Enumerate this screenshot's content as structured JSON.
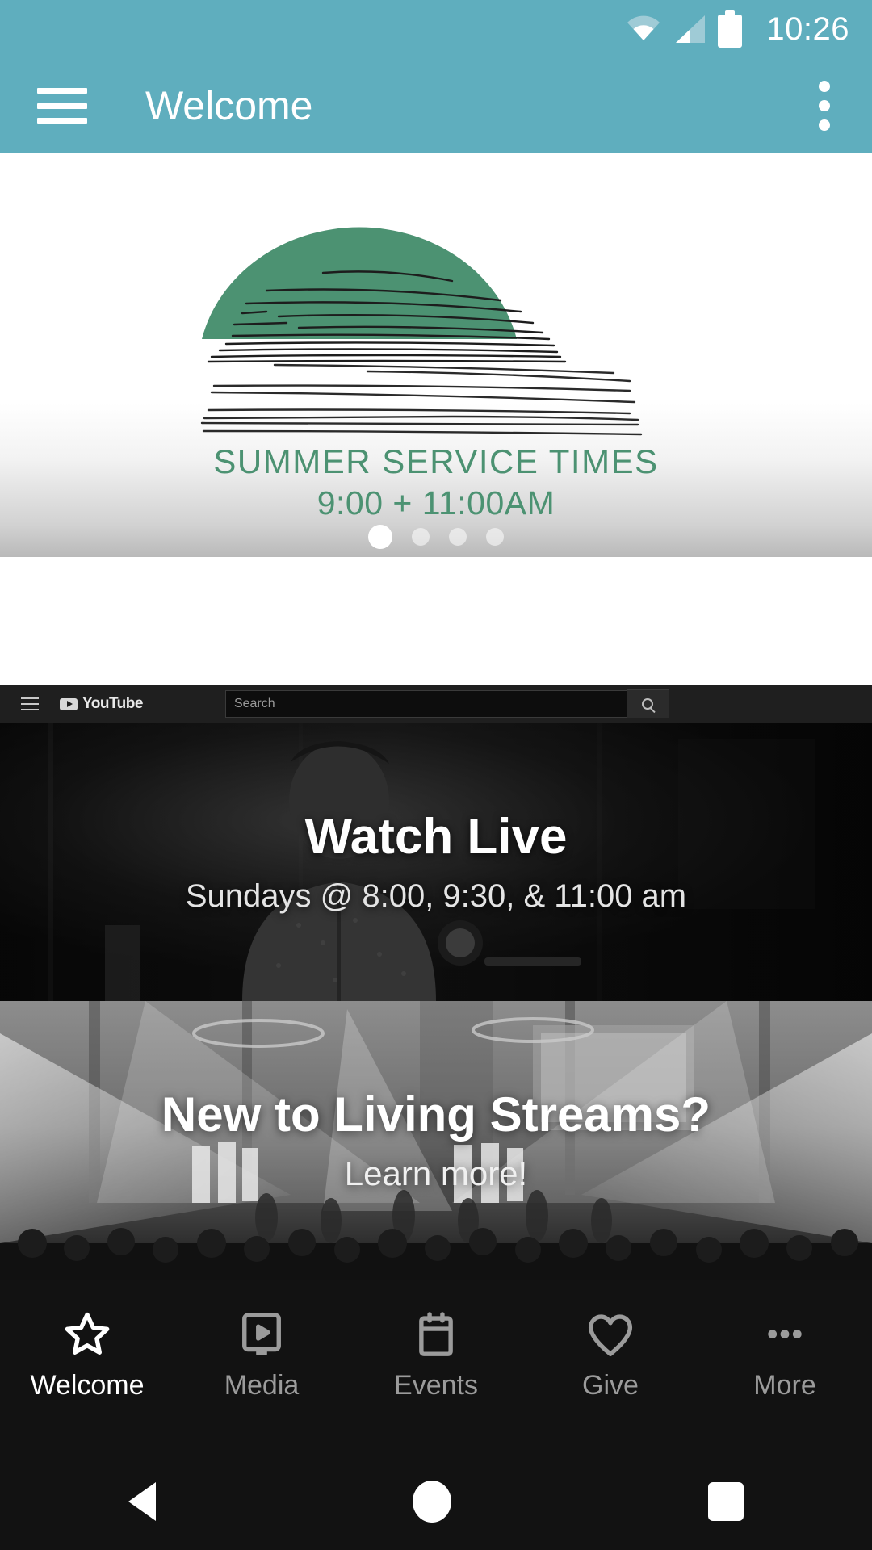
{
  "status_bar": {
    "time": "10:26",
    "icons": [
      "wifi-icon",
      "cellular-signal-icon",
      "battery-icon"
    ]
  },
  "app_bar": {
    "title": "Welcome",
    "menu_icon": "hamburger-menu-icon",
    "overflow_icon": "overflow-menu-icon"
  },
  "hero": {
    "title": "SUMMER SERVICE TIMES",
    "subtitle": "9:00  +  11:00AM",
    "art": "sunset-illustration",
    "sun_color": "#4C9272",
    "text_color": "#4C9272",
    "dots_total": 4,
    "active_dot": 1
  },
  "youtube_bar": {
    "menu_icon": "hamburger-menu-icon",
    "logo_text": "YouTube",
    "search_placeholder": "Search",
    "search_value": "",
    "search_icon": "magnifier-icon"
  },
  "cards": [
    {
      "title": "Watch Live",
      "subtitle": "Sundays @ 8:00, 9:30, & 11:00 am",
      "image": "worship-leader-photo"
    },
    {
      "title": "New to Living Streams?",
      "subtitle": "Learn more!",
      "image": "auditorium-stage-lights-photo"
    }
  ],
  "tabs": [
    {
      "label": "Welcome",
      "icon": "star-icon",
      "active": true
    },
    {
      "label": "Media",
      "icon": "tv-play-icon",
      "active": false
    },
    {
      "label": "Events",
      "icon": "calendar-icon",
      "active": false
    },
    {
      "label": "Give",
      "icon": "heart-icon",
      "active": false
    },
    {
      "label": "More",
      "icon": "ellipsis-icon",
      "active": false
    }
  ],
  "system_nav": {
    "back": "back-triangle-icon",
    "home": "home-circle-icon",
    "recents": "recents-square-icon"
  },
  "colors": {
    "accent_teal": "#5FAEBE",
    "accent_green": "#4C9272",
    "tabbar_bg": "#121212",
    "tab_inactive": "#9B9B9B",
    "tab_active": "#FFFFFF"
  }
}
